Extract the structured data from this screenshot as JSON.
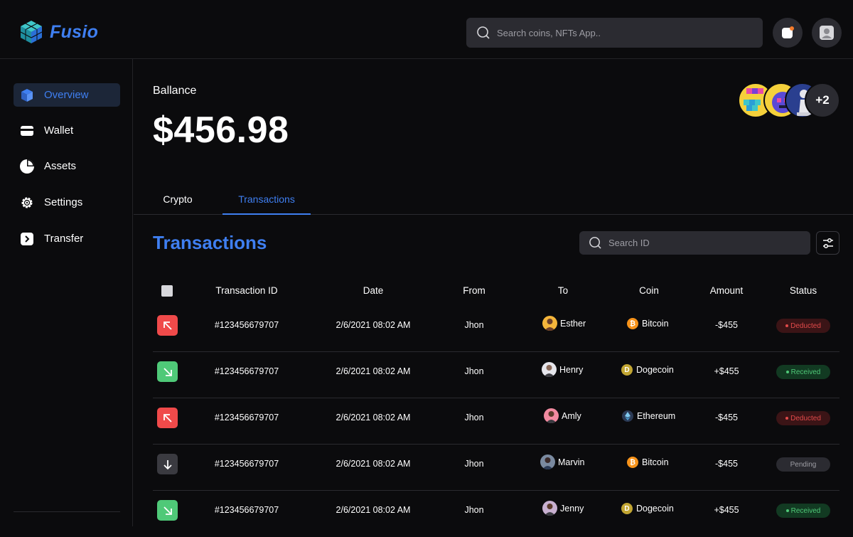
{
  "brand": {
    "name": "Fusio",
    "accent": "#3f7ff1"
  },
  "header": {
    "search_placeholder": "Search coins, NFTs App.."
  },
  "sidebar": {
    "items": [
      {
        "label": "Overview",
        "icon": "cube-icon",
        "active": true
      },
      {
        "label": "Wallet",
        "icon": "wallet-icon",
        "active": false
      },
      {
        "label": "Assets",
        "icon": "pie-chart-icon",
        "active": false
      },
      {
        "label": "Settings",
        "icon": "gear-icon",
        "active": false
      },
      {
        "label": "Transfer",
        "icon": "transfer-icon",
        "active": false
      }
    ]
  },
  "balance": {
    "label": "Ballance",
    "value": "$456.98"
  },
  "collectors": {
    "more": "+2"
  },
  "tabs": [
    {
      "label": "Crypto",
      "active": false
    },
    {
      "label": "Transactions",
      "active": true
    }
  ],
  "transactions": {
    "title": "Transactions",
    "search_placeholder": "Search ID",
    "columns": [
      "Transaction ID",
      "Date",
      "From",
      "To",
      "Coin",
      "Amount",
      "Status"
    ],
    "rows": [
      {
        "direction": "out",
        "id": "#123456679707",
        "date": "2/6/2021 08:02 AM",
        "from": "Jhon",
        "to": "Esther",
        "coin": "Bitcoin",
        "amount": "-$455",
        "status": "Deducted"
      },
      {
        "direction": "in",
        "id": "#123456679707",
        "date": "2/6/2021 08:02 AM",
        "from": "Jhon",
        "to": "Henry",
        "coin": "Dogecoin",
        "amount": "+$455",
        "status": "Received"
      },
      {
        "direction": "out",
        "id": "#123456679707",
        "date": "2/6/2021 08:02 AM",
        "from": "Jhon",
        "to": "Amly",
        "coin": "Ethereum",
        "amount": "-$455",
        "status": "Deducted"
      },
      {
        "direction": "pend",
        "id": "#123456679707",
        "date": "2/6/2021 08:02 AM",
        "from": "Jhon",
        "to": "Marvin",
        "coin": "Bitcoin",
        "amount": "-$455",
        "status": "Pending"
      },
      {
        "direction": "in",
        "id": "#123456679707",
        "date": "2/6/2021 08:02 AM",
        "from": "Jhon",
        "to": "Jenny",
        "coin": "Dogecoin",
        "amount": "+$455",
        "status": "Received"
      }
    ]
  },
  "status_colors": {
    "deducted": "#e24a4a",
    "received": "#4fc978",
    "pending": "#9d9da4"
  }
}
